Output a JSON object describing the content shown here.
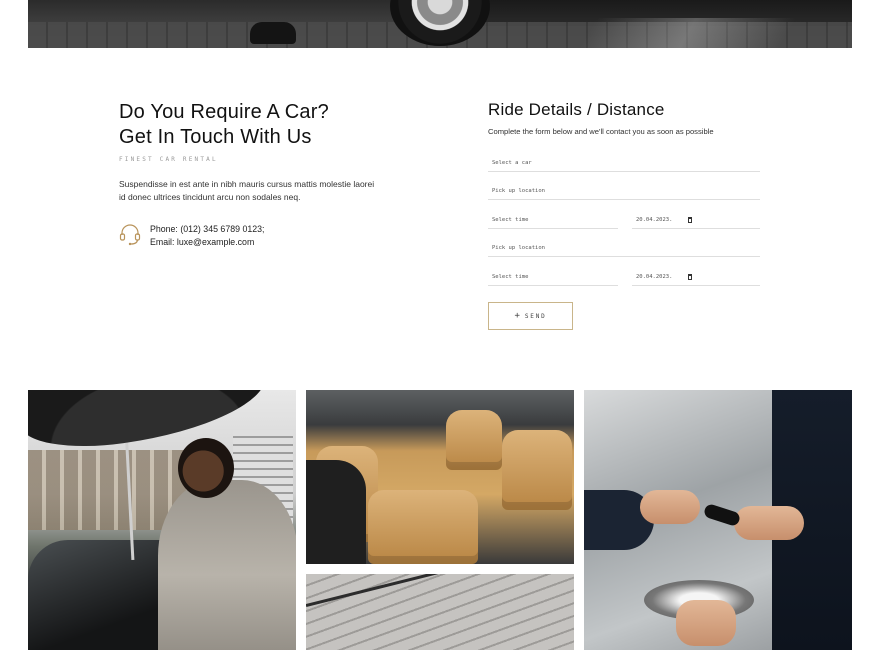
{
  "contact": {
    "heading_line1": "Do You Require A Car?",
    "heading_line2": "Get In Touch With Us",
    "eyebrow": "Finest Car Rental",
    "description": "Suspendisse in est ante in nibh mauris cursus mattis molestie laorei id donec ultrices tincidunt arcu non sodales neq.",
    "phone": "Phone: (012) 345 6789 0123;",
    "email": "Email: luxe@example.com",
    "icon": "headset-icon"
  },
  "form": {
    "title": "Ride Details / Distance",
    "subtitle": "Complete the form below and we'll contact you as soon as possible",
    "select_car": "Select a car",
    "pickup_location_1": "Pick up location",
    "select_time_1": "Select time",
    "date_1": "20.04.2023.",
    "pickup_location_2": "Pick up location",
    "select_time_2": "Select time",
    "date_2": "20.04.2023.",
    "send_label": "SEND",
    "send_icon": "+"
  },
  "colors": {
    "accent_border": "#c9b58a",
    "text": "#1a1a1a"
  }
}
